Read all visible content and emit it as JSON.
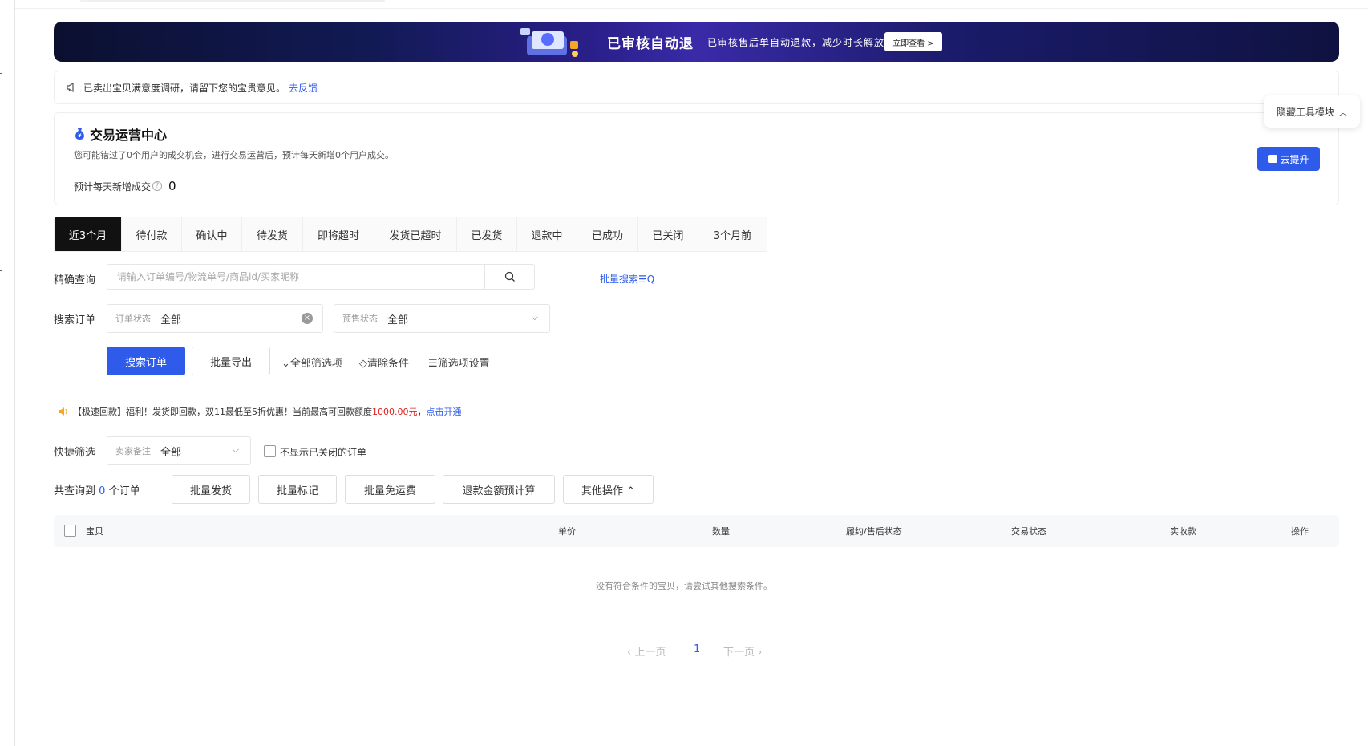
{
  "banner": {
    "title": "已审核自动退",
    "subtitle": "已审核售后单自动退款，减少时长解放人力",
    "button": "立即查看 >"
  },
  "feedback": {
    "text": "已卖出宝贝满意度调研，请留下您的宝贵意见。",
    "link": "去反馈"
  },
  "center": {
    "title": "交易运营中心",
    "desc": "您可能错过了0个用户的成交机会，进行交易运营后，预计每天新增0个用户成交。",
    "stat_label": "预计每天新增成交",
    "stat_help": "?",
    "stat_value": "0",
    "upgrade_button": "去提升",
    "hide_tools": "隐藏工具模块",
    "hide_tools_chevron": "︿"
  },
  "tabs": [
    {
      "label": "近3个月",
      "active": true
    },
    {
      "label": "待付款"
    },
    {
      "label": "确认中"
    },
    {
      "label": "待发货"
    },
    {
      "label": "即将超时"
    },
    {
      "label": "发货已超时"
    },
    {
      "label": "已发货"
    },
    {
      "label": "退款中"
    },
    {
      "label": "已成功"
    },
    {
      "label": "已关闭"
    },
    {
      "label": "3个月前"
    }
  ],
  "search": {
    "precise_label": "精确查询",
    "precise_placeholder": "请输入订单编号/物流单号/商品id/买家昵称",
    "batch_search": "批量搜索",
    "batch_search_icon": "☰Q",
    "order_label": "搜索订单",
    "order_status_key": "订单状态",
    "order_status_value": "全部",
    "presale_key": "预售状态",
    "presale_value": "全部",
    "chevron": "⌵",
    "clear": "×",
    "search_button": "搜索订单",
    "export_button": "批量导出",
    "all_filters": "⌄全部筛选项",
    "clear_conditions": "◇清除条件",
    "filter_settings": "☰筛选项设置"
  },
  "promo": {
    "prefix": "【极速回款】福利！发货即回款，双11最低至5折优惠！当前最高可回款额度",
    "amount": "1000.00元",
    "separator": "，",
    "link": "点击开通"
  },
  "quick": {
    "label": "快捷筛选",
    "remark_key": "卖家备注",
    "remark_value": "全部",
    "hide_closed": "不显示已关闭的订单"
  },
  "results": {
    "prefix": "共查询到",
    "count": "0",
    "suffix": "个订单",
    "actions": [
      "批量发货",
      "批量标记",
      "批量免运费",
      "退款金额预计算",
      "其他操作 ⌃"
    ]
  },
  "table": {
    "headers": [
      "宝贝",
      "单价",
      "数量",
      "履约/售后状态",
      "交易状态",
      "实收款",
      "操作"
    ],
    "empty": "没有符合条件的宝贝，请尝试其他搜索条件。"
  },
  "pagination": {
    "prev": "‹ 上一页",
    "current": "1",
    "next": "下一页 ›"
  },
  "colors": {
    "primary": "#2f5bea",
    "active_tab": "#111111",
    "price_red": "#e02020"
  }
}
